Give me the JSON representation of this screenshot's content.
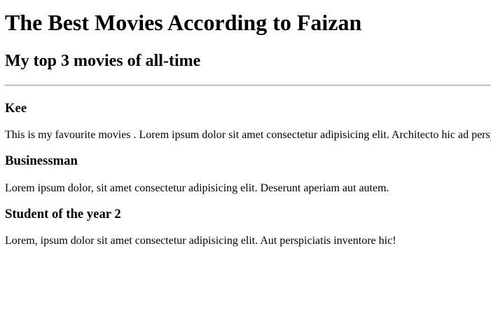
{
  "page": {
    "title": "The Best Movies According to Faizan",
    "subtitle": "My top 3 movies of all-time"
  },
  "movies": [
    {
      "name": "Kee",
      "description": "This is my favourite movies . Lorem ipsum dolor sit amet consectetur adipisicing elit. Architecto hic ad perspiciatis"
    },
    {
      "name": "Businessman",
      "description": "Lorem ipsum dolor, sit amet consectetur adipisicing elit. Deserunt aperiam aut autem."
    },
    {
      "name": "Student of the year 2",
      "description": "Lorem, ipsum dolor sit amet consectetur adipisicing elit. Aut perspiciatis inventore hic!"
    }
  ]
}
